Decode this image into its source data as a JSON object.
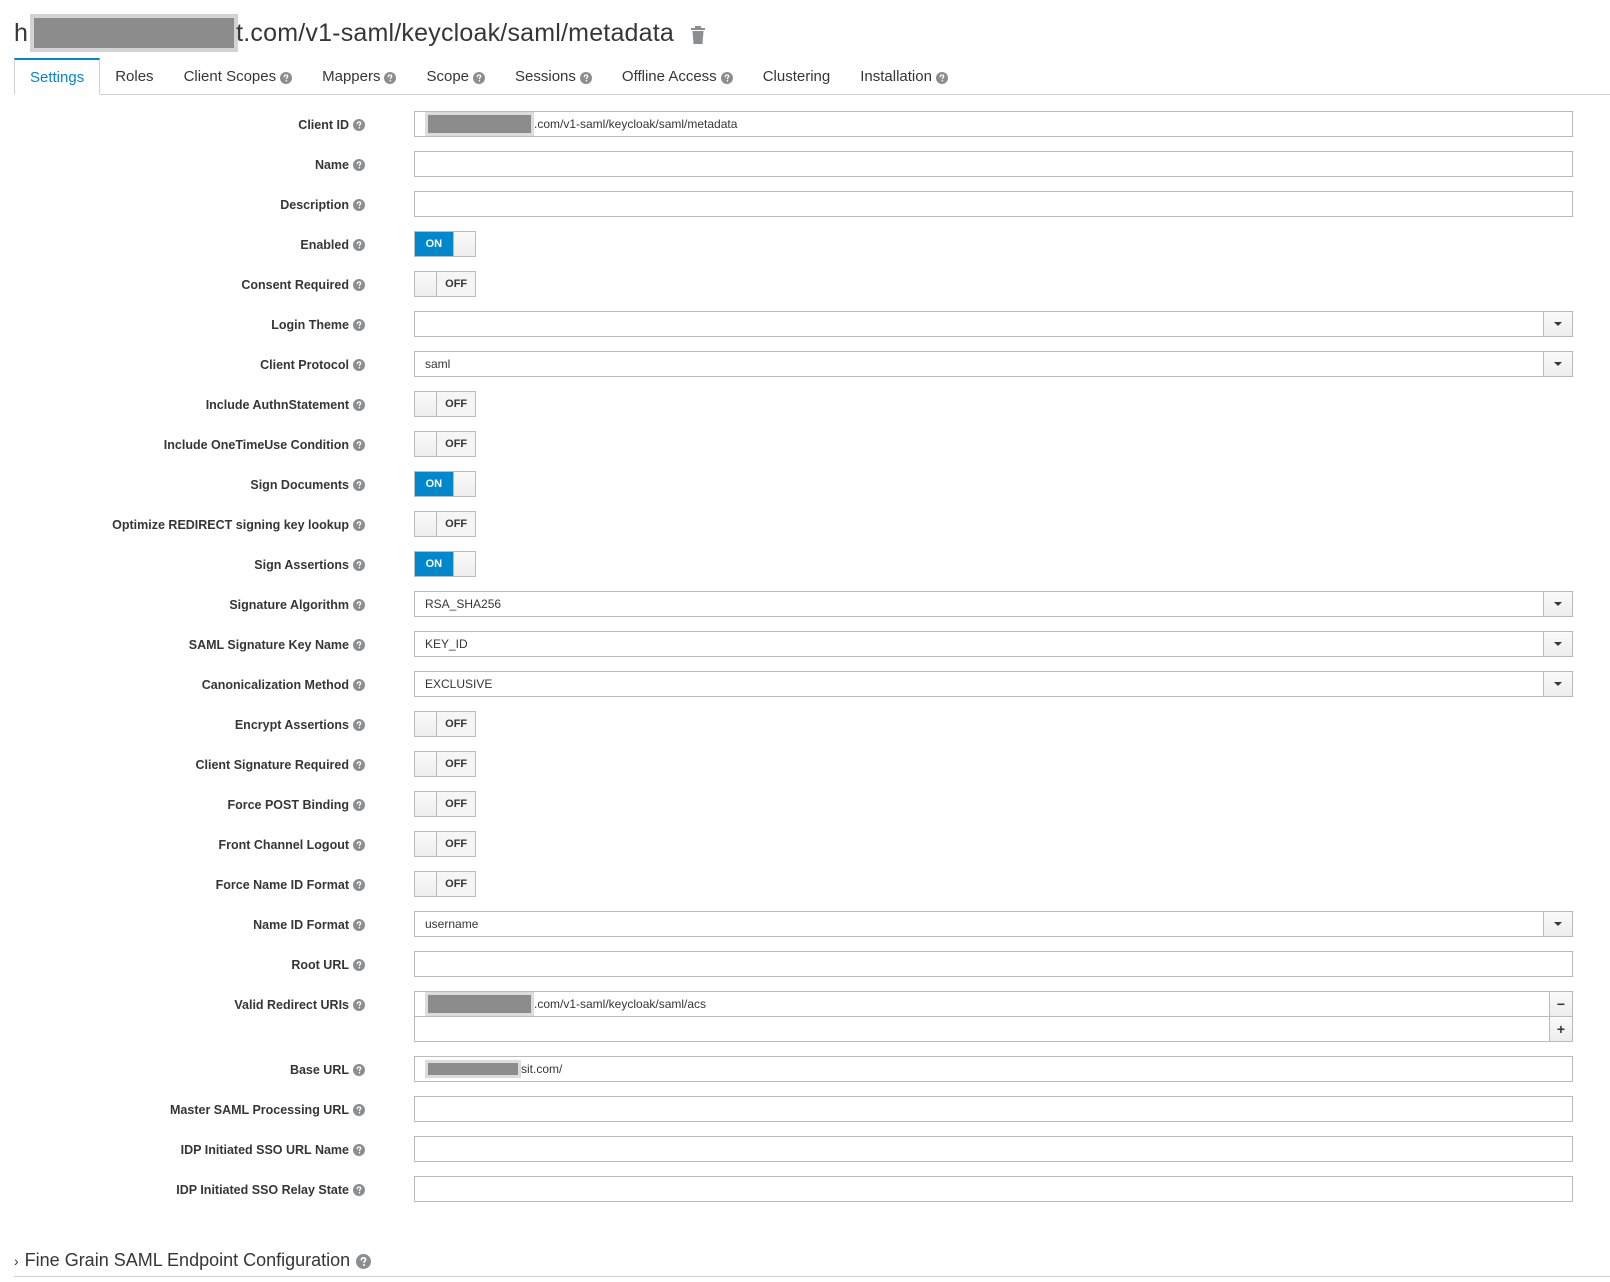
{
  "header": {
    "title_prefix": "h",
    "title_suffix": "t.com/v1-saml/keycloak/saml/metadata",
    "delete_icon": "trash-icon"
  },
  "tabs": [
    {
      "label": "Settings",
      "active": true,
      "help": false
    },
    {
      "label": "Roles",
      "active": false,
      "help": false
    },
    {
      "label": "Client Scopes",
      "active": false,
      "help": true
    },
    {
      "label": "Mappers",
      "active": false,
      "help": true
    },
    {
      "label": "Scope",
      "active": false,
      "help": true
    },
    {
      "label": "Sessions",
      "active": false,
      "help": true
    },
    {
      "label": "Offline Access",
      "active": false,
      "help": true
    },
    {
      "label": "Clustering",
      "active": false,
      "help": false
    },
    {
      "label": "Installation",
      "active": false,
      "help": true
    }
  ],
  "form": {
    "client_id": {
      "label": "Client ID",
      "value": ".com/v1-saml/keycloak/saml/metadata"
    },
    "name": {
      "label": "Name",
      "value": ""
    },
    "description": {
      "label": "Description",
      "value": ""
    },
    "enabled": {
      "label": "Enabled",
      "state": "ON"
    },
    "consent_required": {
      "label": "Consent Required",
      "state": "OFF"
    },
    "login_theme": {
      "label": "Login Theme",
      "value": ""
    },
    "client_protocol": {
      "label": "Client Protocol",
      "value": "saml"
    },
    "include_authn": {
      "label": "Include AuthnStatement",
      "state": "OFF"
    },
    "include_onetime": {
      "label": "Include OneTimeUse Condition",
      "state": "OFF"
    },
    "sign_documents": {
      "label": "Sign Documents",
      "state": "ON"
    },
    "optimize_redirect": {
      "label": "Optimize REDIRECT signing key lookup",
      "state": "OFF"
    },
    "sign_assertions": {
      "label": "Sign Assertions",
      "state": "ON"
    },
    "signature_algorithm": {
      "label": "Signature Algorithm",
      "value": "RSA_SHA256"
    },
    "saml_sig_key_name": {
      "label": "SAML Signature Key Name",
      "value": "KEY_ID"
    },
    "canonicalization": {
      "label": "Canonicalization Method",
      "value": "EXCLUSIVE"
    },
    "encrypt_assertions": {
      "label": "Encrypt Assertions",
      "state": "OFF"
    },
    "client_sig_required": {
      "label": "Client Signature Required",
      "state": "OFF"
    },
    "force_post": {
      "label": "Force POST Binding",
      "state": "OFF"
    },
    "front_channel": {
      "label": "Front Channel Logout",
      "state": "OFF"
    },
    "force_name_id": {
      "label": "Force Name ID Format",
      "state": "OFF"
    },
    "name_id_format": {
      "label": "Name ID Format",
      "value": "username"
    },
    "root_url": {
      "label": "Root URL",
      "value": ""
    },
    "valid_redirect": {
      "label": "Valid Redirect URIs",
      "value": ".com/v1-saml/keycloak/saml/acs",
      "remove": "−",
      "add": "+"
    },
    "base_url": {
      "label": "Base URL",
      "value": "sit.com/"
    },
    "master_saml": {
      "label": "Master SAML Processing URL",
      "value": ""
    },
    "idp_sso_name": {
      "label": "IDP Initiated SSO URL Name",
      "value": ""
    },
    "idp_sso_relay": {
      "label": "IDP Initiated SSO Relay State",
      "value": ""
    }
  },
  "fine_grain": {
    "label": "Fine Grain SAML Endpoint Configuration",
    "chevron": "›"
  },
  "colors": {
    "accent": "#0088ce",
    "text": "#363636",
    "border": "#bbbbbb"
  }
}
